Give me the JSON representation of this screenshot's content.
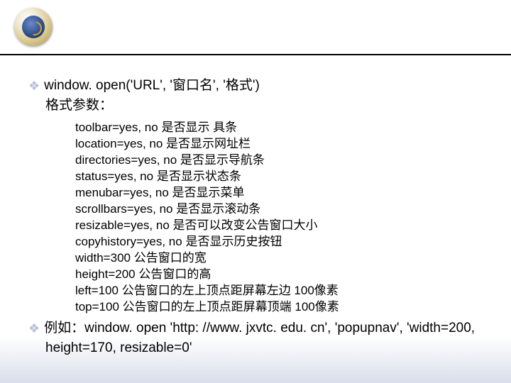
{
  "header": {
    "logo_alt": "institution-seal"
  },
  "slide": {
    "syntax": "window. open('URL', '窗口名', '格式')",
    "params_label": "格式参数：",
    "params": [
      "toolbar=yes, no 是否显示 具条",
      "location=yes, no 是否显示网址栏",
      "directories=yes, no 是否显示导航条",
      "status=yes, no 是否显示状态条",
      "menubar=yes, no 是否显示菜单",
      "scrollbars=yes, no 是否显示滚动条",
      "resizable=yes, no 是否可以改变公告窗口大小",
      "copyhistory=yes, no 是否显示历史按钮",
      "width=300 公告窗口的宽",
      "height=200 公告窗口的高",
      "left=100 公告窗口的左上顶点距屏幕左边 100像素",
      "top=100 公告窗口的左上顶点距屏幕顶端 100像素"
    ],
    "example_line1": "例如：window. open 'http: //www. jxvtc. edu. cn', 'popupnav', 'width=200,",
    "example_line2": "height=170, resizable=0'"
  }
}
